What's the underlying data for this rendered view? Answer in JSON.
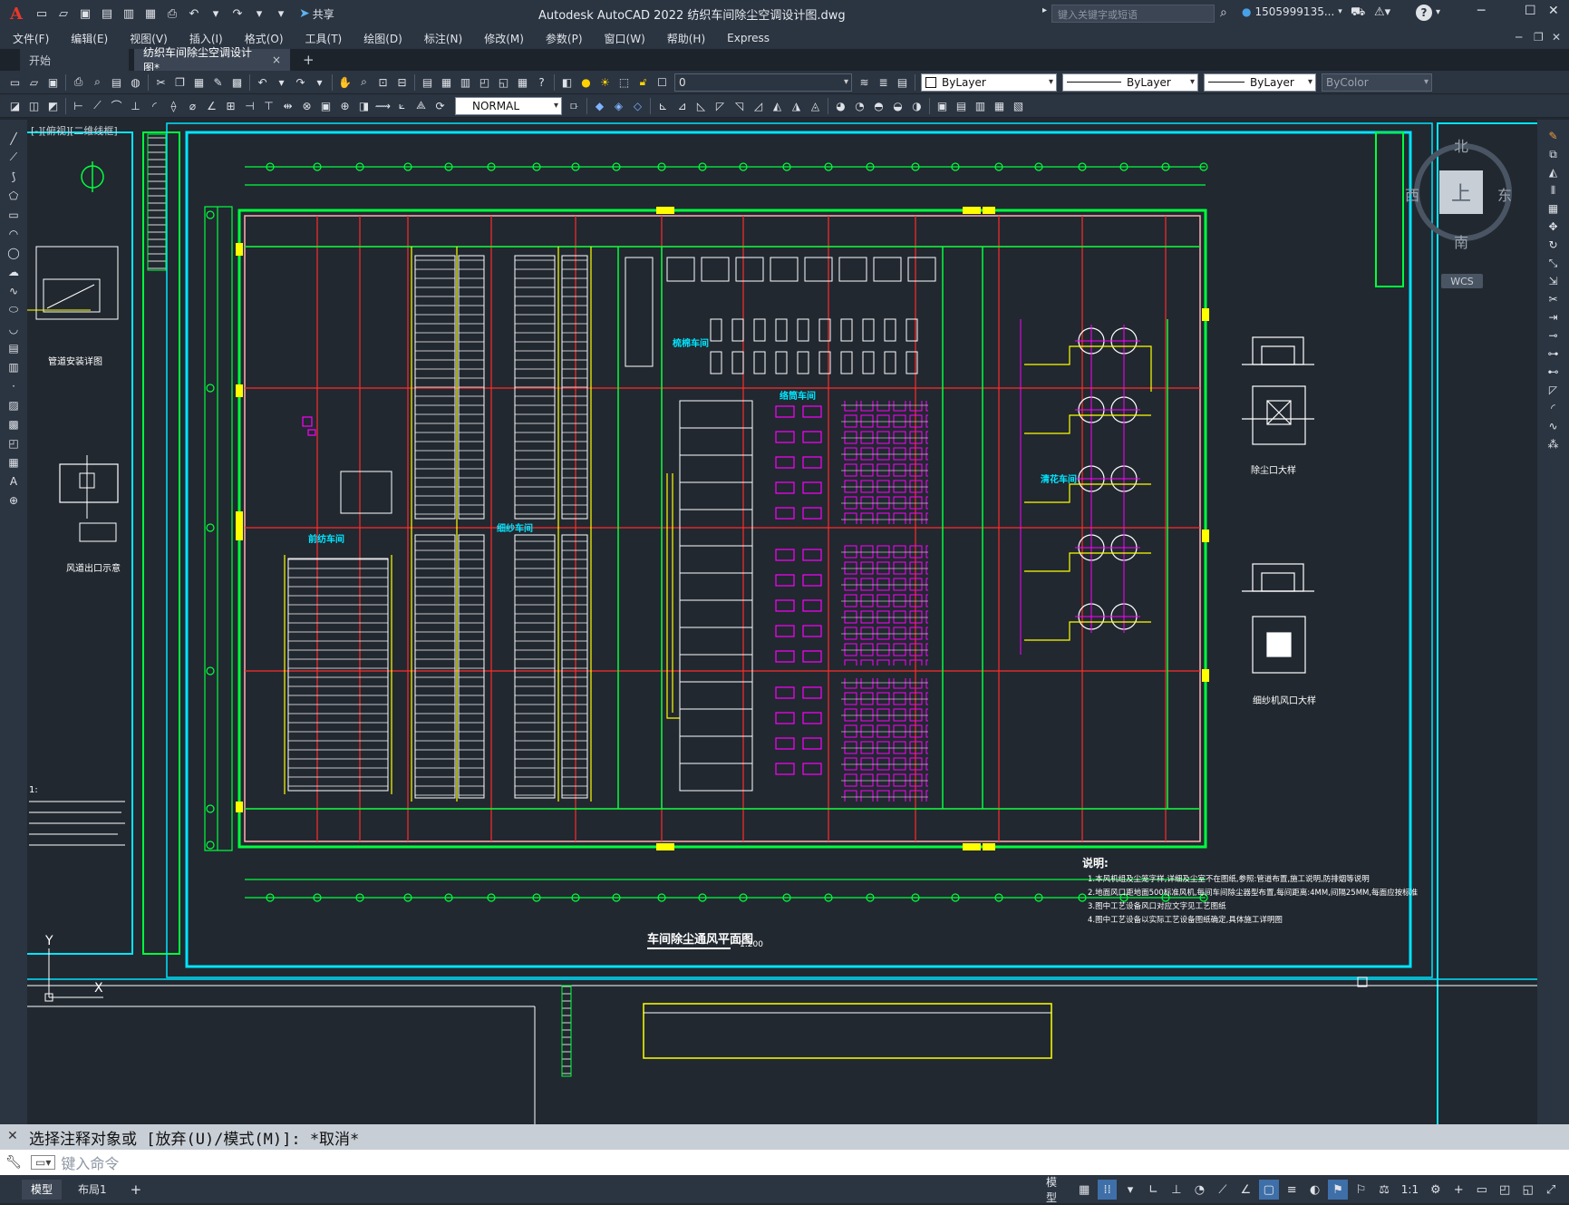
{
  "app": {
    "logo": "A",
    "title": "Autodesk AutoCAD 2022    纺织车间除尘空调设计图.dwg",
    "search_placeholder": "键入关键字或短语",
    "user": "1505999135...",
    "share_label": "共享",
    "help_label": "?"
  },
  "menu": {
    "items": [
      "文件(F)",
      "编辑(E)",
      "视图(V)",
      "插入(I)",
      "格式(O)",
      "工具(T)",
      "绘图(D)",
      "标注(N)",
      "修改(M)",
      "参数(P)",
      "窗口(W)",
      "帮助(H)",
      "Express"
    ]
  },
  "tabs": {
    "start": "开始",
    "active": "纺织车间除尘空调设计图*",
    "close": "×",
    "add": "+"
  },
  "toolbar": {
    "layer": "0",
    "color": "ByLayer",
    "linetype": "ByLayer",
    "lineweight": "ByLayer",
    "plotstyle": "ByColor",
    "dimstyle": "NORMAL"
  },
  "viewport": {
    "label": "[-][俯视][二维线框]",
    "north": "北",
    "south": "南",
    "east": "东",
    "west": "西",
    "top": "上",
    "wcs": "WCS"
  },
  "drawing": {
    "room_rieju": "梳棉车间",
    "room_qianfang": "前纺车间",
    "room_xisha": "细纱车间",
    "room_luotong": "络筒车间",
    "room_qinghua": "清花车间",
    "main_title": "车间除尘通风平面图",
    "main_scale": "1:200",
    "notes_title": "说明:",
    "notes": [
      "1.本风机组及尘笼字样,详细及尘室不在图纸,参照:管道布置,施工说明,防排烟等说明",
      "2.地面风口距地面500标准风机,每间车间除尘器型布置,每间距离:4MM,间隔25MM,每面应按标准",
      "3.图中工艺设备风口对应文字见工艺图纸",
      "4.图中工艺设备以实际工艺设备图纸确定,具体施工详明图"
    ],
    "left_title1": "管道安装详图",
    "left_title2": "风道出口示意",
    "left_note": "1:",
    "right_detail1": "除尘口大样",
    "right_detail2": "细纱机风口大样",
    "axis_y": "Y",
    "axis_x": "X"
  },
  "command": {
    "history": "选择注释对象或 [放弃(U)/模式(M)]: *取消*",
    "placeholder": "键入命令"
  },
  "status": {
    "model_tab": "模型",
    "layout_tab": "布局1",
    "add": "+",
    "model_btn": "模型",
    "scale": "1:1"
  },
  "colors": {
    "bg": "#212830",
    "chrome": "#2b3441",
    "cyan": "#00e5ff",
    "green": "#00ff3c",
    "red": "#ff2b2b",
    "yellow": "#ffff00",
    "magenta": "#ff00ff",
    "white": "#ffffff",
    "pink": "#ffb0b0"
  }
}
